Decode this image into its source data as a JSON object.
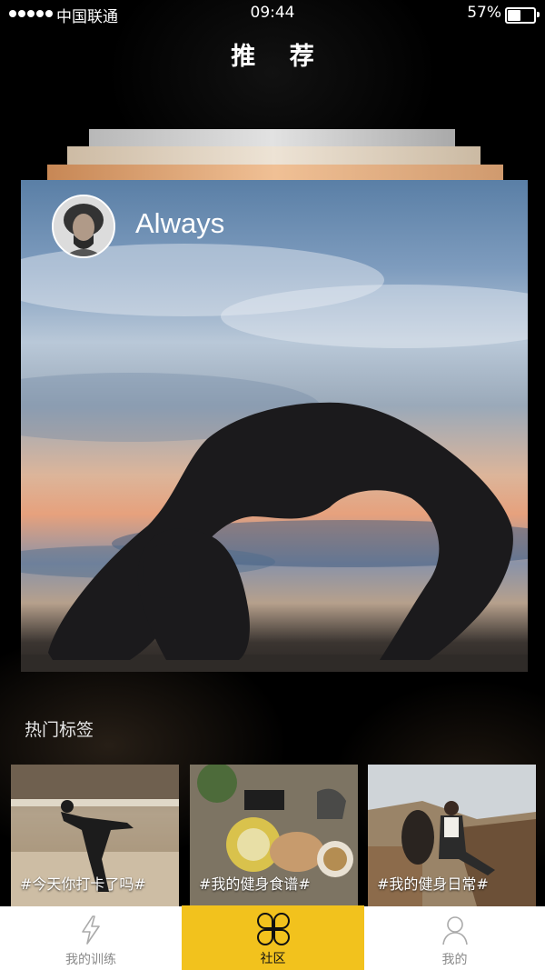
{
  "status_bar": {
    "carrier": "中国联通",
    "time": "09:44",
    "battery_percent": "57%",
    "battery_level": 0.57,
    "signal_bars": 5
  },
  "header": {
    "title": "推 荐"
  },
  "feature_card": {
    "username": "Always"
  },
  "hot_tags": {
    "title": "热门标签",
    "items": [
      {
        "label": "#今天你打卡了吗#"
      },
      {
        "label": "#我的健身食谱#"
      },
      {
        "label": "#我的健身日常#"
      }
    ]
  },
  "tab_bar": {
    "tabs": [
      {
        "label": "我的训练",
        "icon": "lightning-icon",
        "active": false
      },
      {
        "label": "社区",
        "icon": "clover-icon",
        "active": true
      },
      {
        "label": "我的",
        "icon": "person-icon",
        "active": false
      }
    ],
    "active_color": "#f2c21d"
  }
}
